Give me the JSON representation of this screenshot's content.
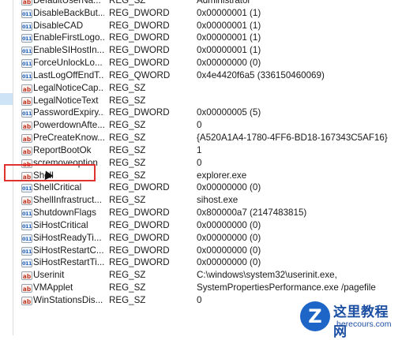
{
  "rows": [
    {
      "name": "DefaultUserNa...",
      "type": "REG_SZ",
      "data": "Administrator",
      "icon": "sz"
    },
    {
      "name": "DisableBackBut...",
      "type": "REG_DWORD",
      "data": "0x00000001 (1)",
      "icon": "bin"
    },
    {
      "name": "DisableCAD",
      "type": "REG_DWORD",
      "data": "0x00000001 (1)",
      "icon": "bin"
    },
    {
      "name": "EnableFirstLogo...",
      "type": "REG_DWORD",
      "data": "0x00000001 (1)",
      "icon": "bin"
    },
    {
      "name": "EnableSIHostIn...",
      "type": "REG_DWORD",
      "data": "0x00000001 (1)",
      "icon": "bin"
    },
    {
      "name": "ForceUnlockLo...",
      "type": "REG_DWORD",
      "data": "0x00000000 (0)",
      "icon": "bin"
    },
    {
      "name": "LastLogOffEndT...",
      "type": "REG_QWORD",
      "data": "0x4e4420f6a5 (336150460069)",
      "icon": "bin"
    },
    {
      "name": "LegalNoticeCap...",
      "type": "REG_SZ",
      "data": "",
      "icon": "sz"
    },
    {
      "name": "LegalNoticeText",
      "type": "REG_SZ",
      "data": "",
      "icon": "sz"
    },
    {
      "name": "PasswordExpiry...",
      "type": "REG_DWORD",
      "data": "0x00000005 (5)",
      "icon": "bin"
    },
    {
      "name": "PowerdownAfte...",
      "type": "REG_SZ",
      "data": "0",
      "icon": "sz"
    },
    {
      "name": "PreCreateKnow...",
      "type": "REG_SZ",
      "data": "{A520A1A4-1780-4FF6-BD18-167343C5AF16}",
      "icon": "sz"
    },
    {
      "name": "ReportBootOk",
      "type": "REG_SZ",
      "data": "1",
      "icon": "sz"
    },
    {
      "name": "scremoveoption",
      "type": "REG_SZ",
      "data": "0",
      "icon": "sz"
    },
    {
      "name": "Shell",
      "type": "REG_SZ",
      "data": "explorer.exe",
      "icon": "sz"
    },
    {
      "name": "ShellCritical",
      "type": "REG_DWORD",
      "data": "0x00000000 (0)",
      "icon": "bin"
    },
    {
      "name": "ShellInfrastruct...",
      "type": "REG_SZ",
      "data": "sihost.exe",
      "icon": "sz"
    },
    {
      "name": "ShutdownFlags",
      "type": "REG_DWORD",
      "data": "0x800000a7 (2147483815)",
      "icon": "bin"
    },
    {
      "name": "SiHostCritical",
      "type": "REG_DWORD",
      "data": "0x00000000 (0)",
      "icon": "bin"
    },
    {
      "name": "SiHostReadyTi...",
      "type": "REG_DWORD",
      "data": "0x00000000 (0)",
      "icon": "bin"
    },
    {
      "name": "SiHostRestartC...",
      "type": "REG_DWORD",
      "data": "0x00000000 (0)",
      "icon": "bin"
    },
    {
      "name": "SiHostRestartTi...",
      "type": "REG_DWORD",
      "data": "0x00000000 (0)",
      "icon": "bin"
    },
    {
      "name": "Userinit",
      "type": "REG_SZ",
      "data": "C:\\windows\\system32\\userinit.exe,",
      "icon": "sz"
    },
    {
      "name": "VMApplet",
      "type": "REG_SZ",
      "data": "SystemPropertiesPerformance.exe /pagefile",
      "icon": "sz"
    },
    {
      "name": "WinStationsDis...",
      "type": "REG_SZ",
      "data": "0",
      "icon": "sz"
    }
  ],
  "icon_labels": {
    "sz": "ab",
    "bin": "011"
  },
  "highlighted_row": "Shell",
  "highlight_color": "#e0322e",
  "watermark": {
    "logo": "Z",
    "title": "这里教程网",
    "subtitle": "herecours.com"
  }
}
